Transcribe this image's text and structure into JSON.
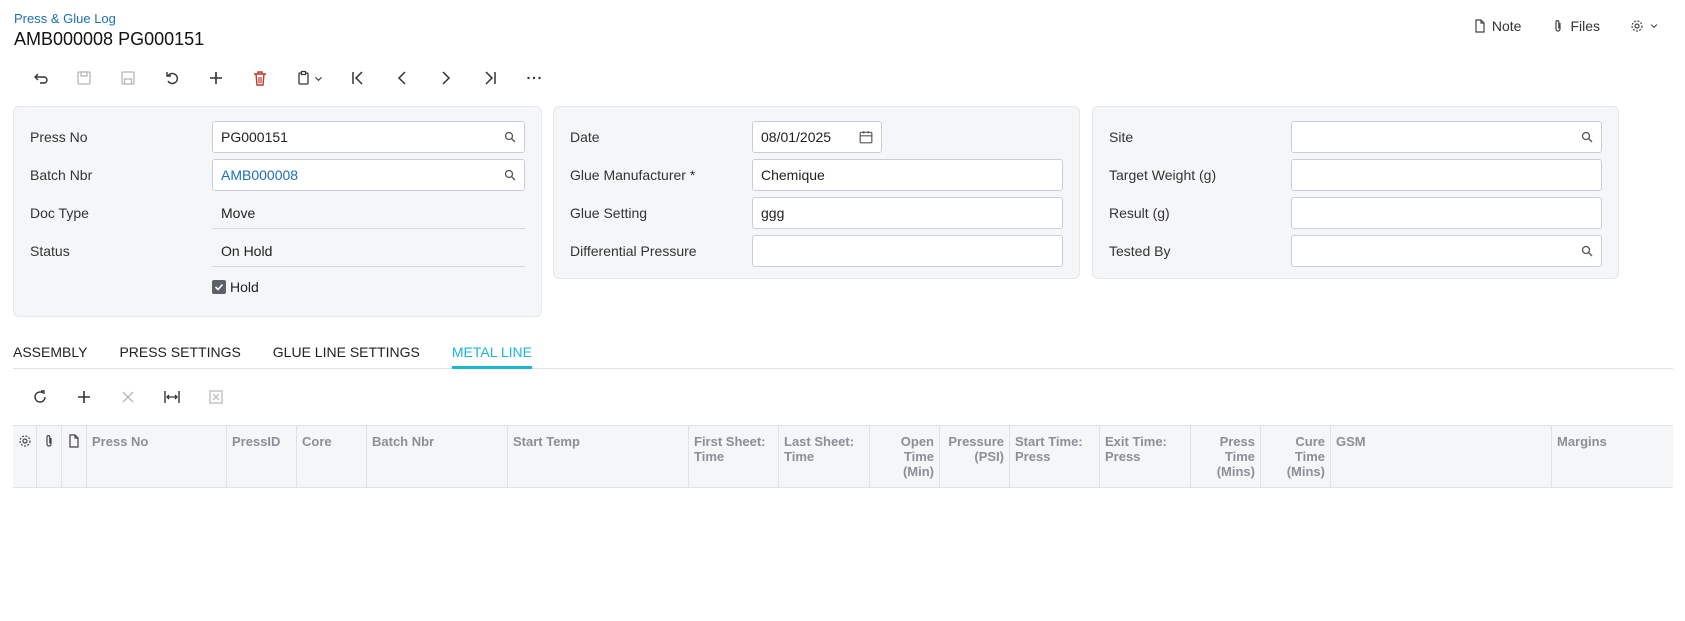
{
  "header": {
    "breadcrumb": "Press & Glue Log",
    "title": "AMB000008 PG000151",
    "actions": {
      "note": "Note",
      "files": "Files"
    }
  },
  "form": {
    "press_no": {
      "label": "Press No",
      "value": "PG000151"
    },
    "batch_nbr": {
      "label": "Batch Nbr",
      "value": "AMB000008"
    },
    "doc_type": {
      "label": "Doc Type",
      "value": "Move"
    },
    "status": {
      "label": "Status",
      "value": "On Hold"
    },
    "hold": {
      "label": "Hold",
      "checked": true
    },
    "date": {
      "label": "Date",
      "value": "08/01/2025"
    },
    "glue_manufacturer": {
      "label": "Glue Manufacturer *",
      "value": "Chemique"
    },
    "glue_setting": {
      "label": "Glue Setting",
      "value": "ggg"
    },
    "differential_pressure": {
      "label": "Differential Pressure",
      "value": ""
    },
    "site": {
      "label": "Site",
      "value": ""
    },
    "target_weight": {
      "label": "Target Weight (g)",
      "value": ""
    },
    "result": {
      "label": "Result (g)",
      "value": ""
    },
    "tested_by": {
      "label": "Tested By",
      "value": ""
    }
  },
  "tabs": [
    {
      "label": "ASSEMBLY",
      "active": false
    },
    {
      "label": "PRESS SETTINGS",
      "active": false
    },
    {
      "label": "GLUE LINE SETTINGS",
      "active": false
    },
    {
      "label": "METAL LINE",
      "active": true
    }
  ],
  "grid": {
    "columns": [
      "Press No",
      "PressID",
      "Core",
      "Batch Nbr",
      "Start Temp",
      "First Sheet: Time",
      "Last Sheet: Time",
      "Open Time (Min)",
      "Pressure (PSI)",
      "Start Time: Press",
      "Exit Time: Press",
      "Press Time (Mins)",
      "Cure Time (Mins)",
      "GSM",
      "Margins"
    ]
  },
  "colors": {
    "accent": "#19b6d6",
    "link": "#1c6fb3",
    "panel": "#f5f6f8"
  }
}
